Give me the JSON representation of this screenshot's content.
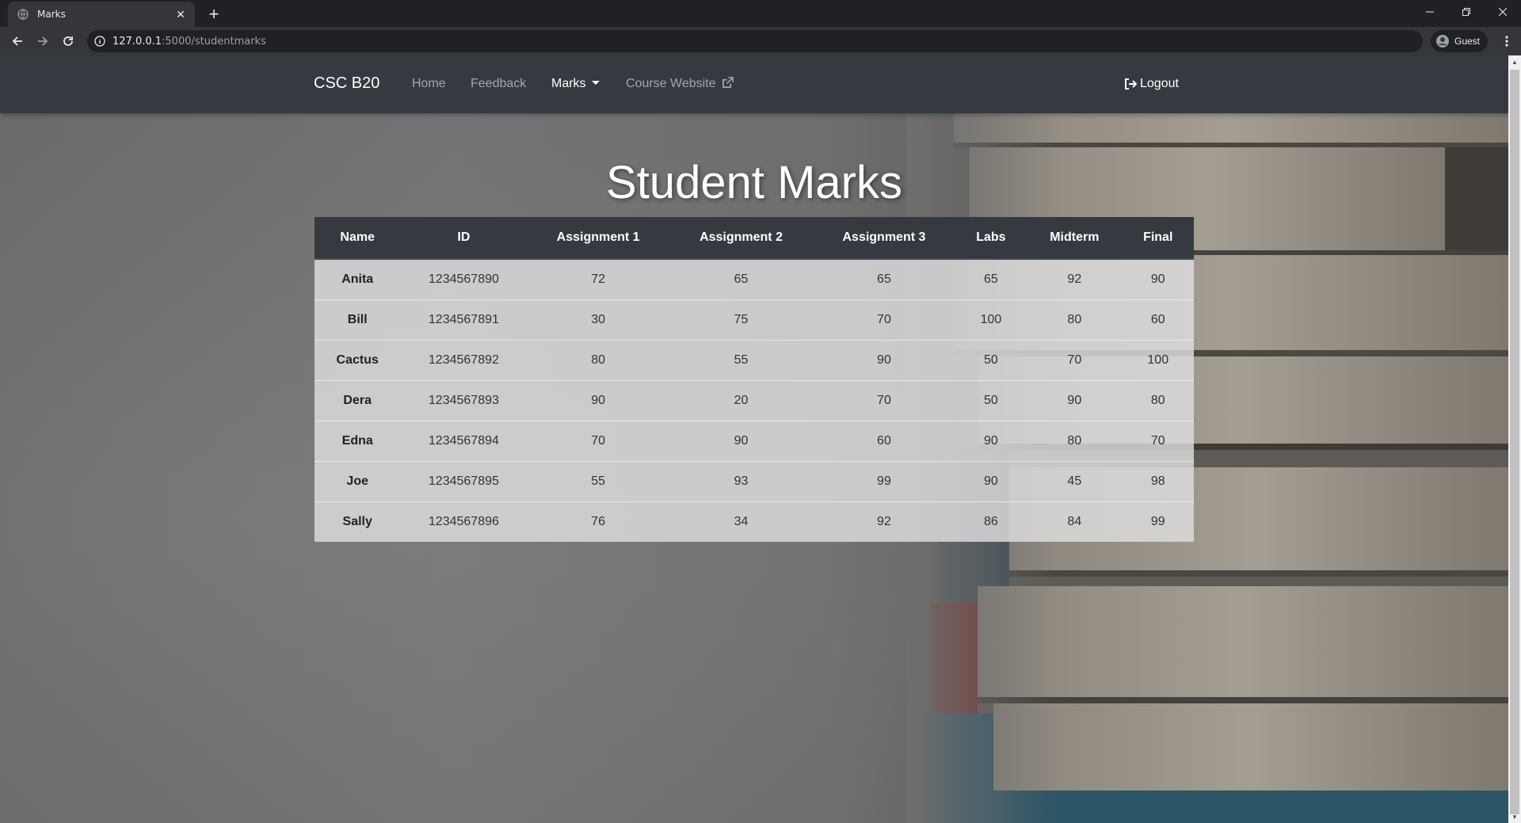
{
  "browser": {
    "tab_title": "Marks",
    "url_host": "127.0.0.1",
    "url_rest": ":5000/studentmarks",
    "profile_label": "Guest"
  },
  "nav": {
    "brand": "CSC B20",
    "links": [
      "Home",
      "Feedback",
      "Marks",
      "Course Website"
    ],
    "logout": "Logout"
  },
  "page": {
    "title": "Student Marks"
  },
  "table": {
    "headers": [
      "Name",
      "ID",
      "Assignment 1",
      "Assignment 2",
      "Assignment 3",
      "Labs",
      "Midterm",
      "Final"
    ],
    "rows": [
      [
        "Anita",
        "1234567890",
        "72",
        "65",
        "65",
        "65",
        "92",
        "90"
      ],
      [
        "Bill",
        "1234567891",
        "30",
        "75",
        "70",
        "100",
        "80",
        "60"
      ],
      [
        "Cactus",
        "1234567892",
        "80",
        "55",
        "90",
        "50",
        "70",
        "100"
      ],
      [
        "Dera",
        "1234567893",
        "90",
        "20",
        "70",
        "50",
        "90",
        "80"
      ],
      [
        "Edna",
        "1234567894",
        "70",
        "90",
        "60",
        "90",
        "80",
        "70"
      ],
      [
        "Joe",
        "1234567895",
        "55",
        "93",
        "99",
        "90",
        "45",
        "98"
      ],
      [
        "Sally",
        "1234567896",
        "76",
        "34",
        "92",
        "86",
        "84",
        "99"
      ]
    ]
  },
  "colors": {
    "navbar": "#343a40",
    "chrome_dark": "#202124",
    "chrome_toolbar": "#35363a"
  }
}
